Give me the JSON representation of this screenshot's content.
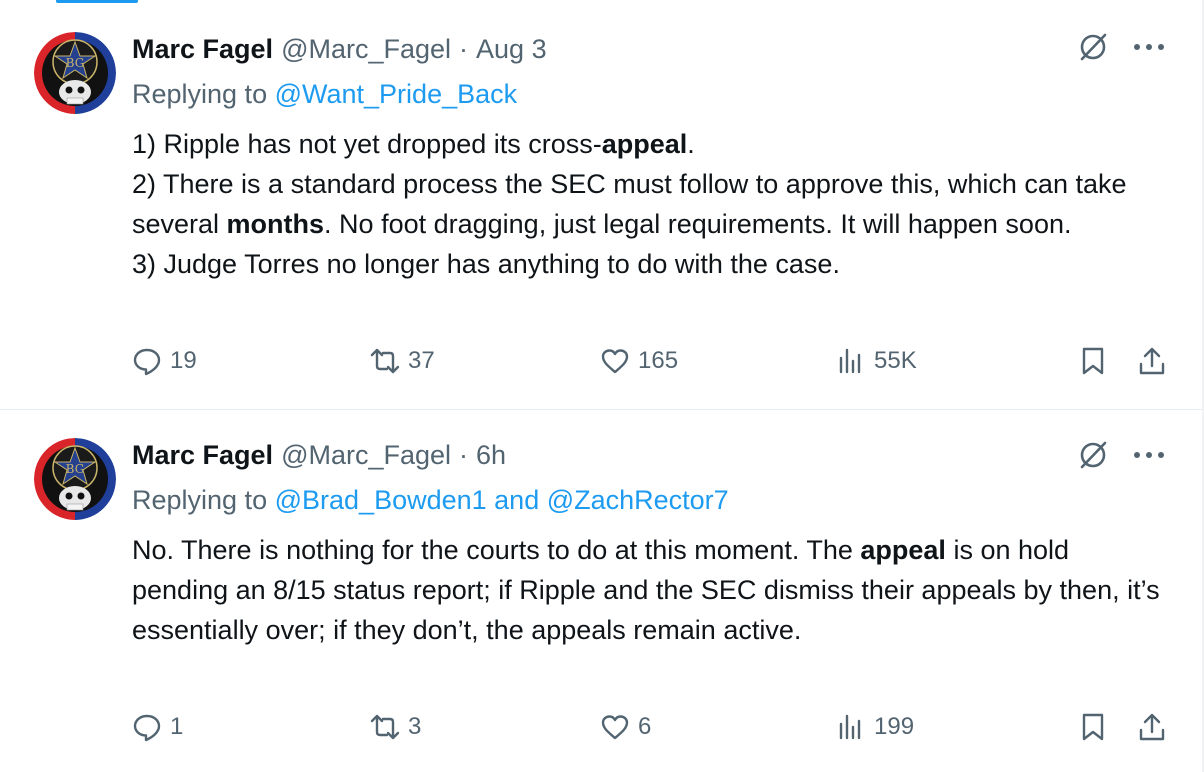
{
  "tweets": [
    {
      "author_name": "Marc Fagel",
      "handle": "@Marc_Fagel",
      "separator": "·",
      "time": "Aug 3",
      "replying_prefix": "Replying to",
      "replying_to": "@Want_Pride_Back",
      "body": [
        [
          {
            "t": "1) Ripple has not yet dropped its cross-"
          },
          {
            "t": "appeal",
            "b": true
          },
          {
            "t": "."
          }
        ],
        [
          {
            "t": "2) There is a standard process the SEC must follow to approve this, which can take several "
          },
          {
            "t": "months",
            "b": true
          },
          {
            "t": ". No foot dragging, just legal requirements. It will happen soon."
          }
        ],
        [
          {
            "t": "3) Judge Torres no longer has anything to do with the case."
          }
        ]
      ],
      "stats": {
        "replies": "19",
        "reposts": "37",
        "likes": "165",
        "views": "55K"
      }
    },
    {
      "author_name": "Marc Fagel",
      "handle": "@Marc_Fagel",
      "separator": "·",
      "time": "6h",
      "replying_prefix": "Replying to",
      "replying_to": "@Brad_Bowden1 and @ZachRector7",
      "body": [
        [
          {
            "t": "No. There is nothing for the courts to do at this moment. The "
          },
          {
            "t": "appeal",
            "b": true
          },
          {
            "t": " is on hold pending an 8/15 status report; if Ripple and the SEC dismiss their appeals by then, it’s essentially over; if they don’t, the appeals remain active."
          }
        ]
      ],
      "stats": {
        "replies": "1",
        "reposts": "3",
        "likes": "6",
        "views": "199"
      }
    }
  ],
  "avatar_text": "BG",
  "icons": [
    "grok-icon",
    "more-icon",
    "reply-icon",
    "repost-icon",
    "like-icon",
    "views-icon",
    "bookmark-icon",
    "share-icon"
  ],
  "colors": {
    "accent": "#1d9bf0",
    "muted": "#536471",
    "text": "#0f1419",
    "border": "#eff3f4"
  }
}
